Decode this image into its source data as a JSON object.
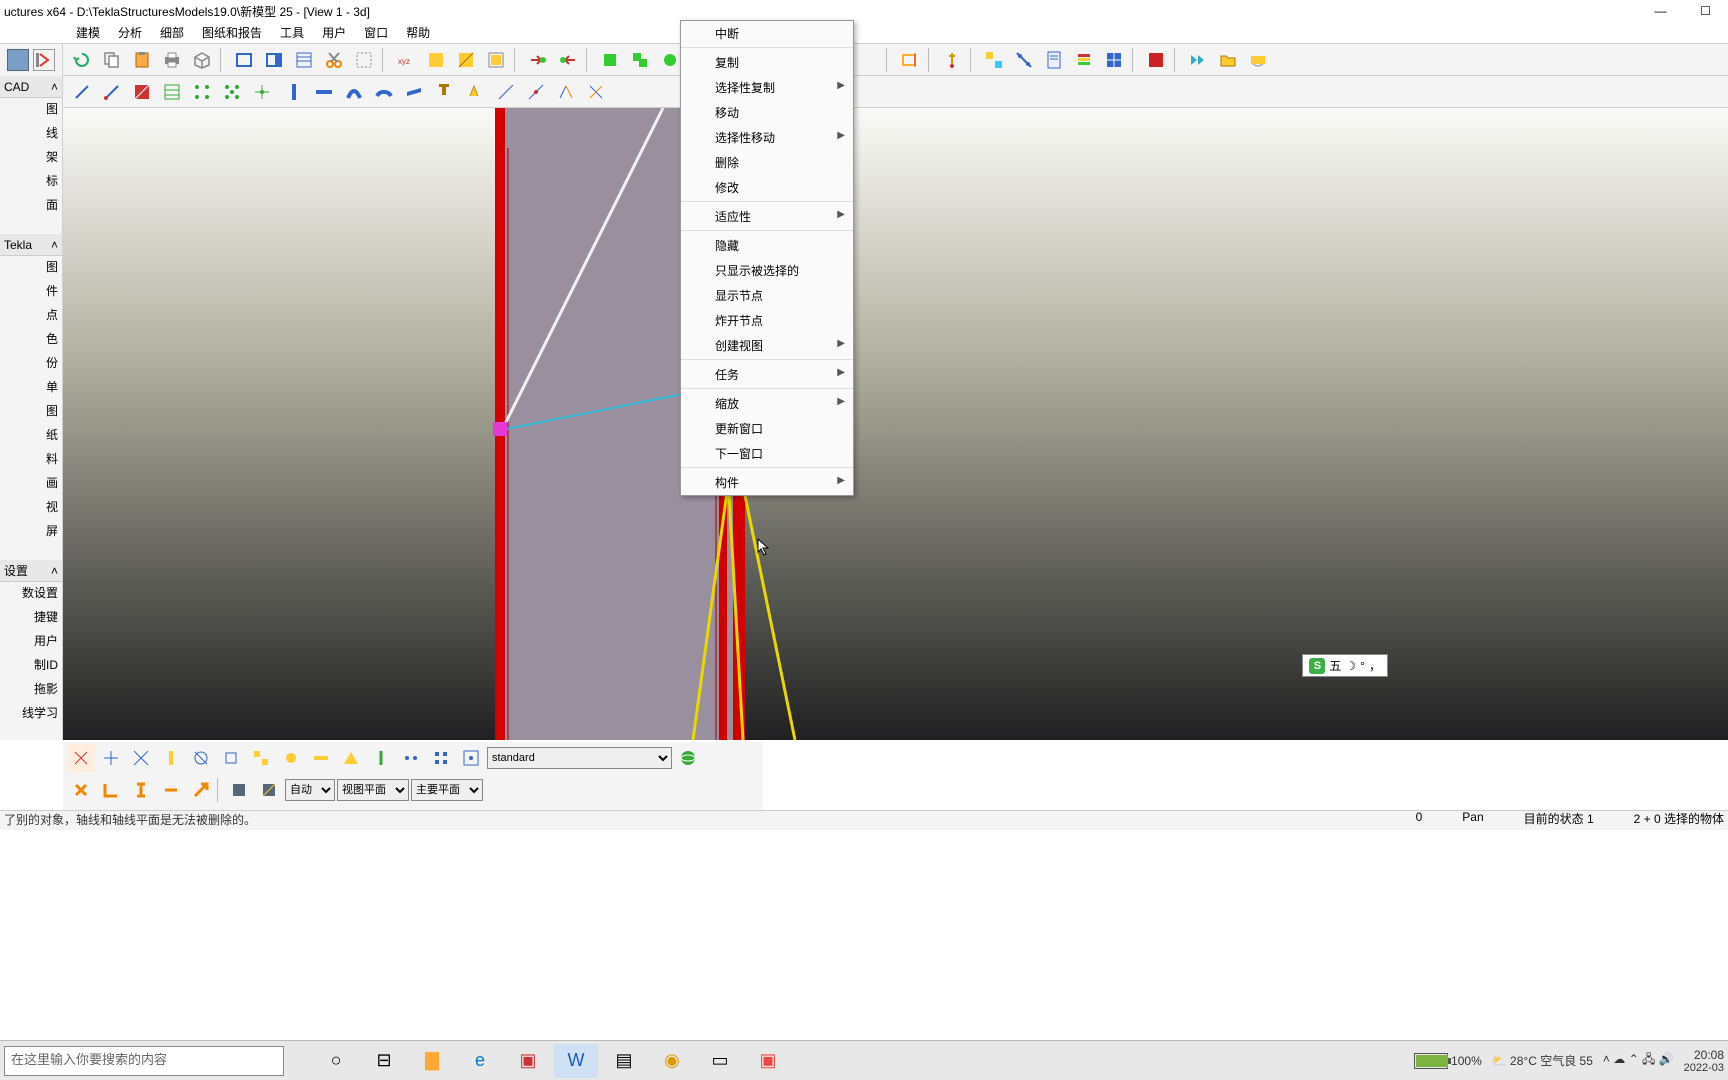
{
  "title": "uctures x64 - D:\\TeklaStructuresModels19.0\\新模型 25 - [View 1 - 3d]",
  "menu": [
    "建模",
    "分析",
    "细部",
    "图纸和报告",
    "工具",
    "用户",
    "窗口",
    "帮助"
  ],
  "side": {
    "hdr1": "CAD",
    "items1": [
      "图",
      "线",
      "架",
      "标",
      "面"
    ],
    "hdr2": "Tekla",
    "items2": [
      "图",
      "件",
      "点",
      "色",
      "份",
      "单",
      "图",
      "纸",
      "料",
      "画",
      "视",
      "屏"
    ],
    "hdr3": "设置",
    "items3": [
      "数设置",
      "捷键",
      "用户",
      "制ID",
      "拖影",
      "线学习"
    ]
  },
  "ctx": [
    {
      "l": "中断",
      "a": false,
      "s": true
    },
    {
      "l": "复制",
      "a": false
    },
    {
      "l": "选择性复制",
      "a": true
    },
    {
      "l": "移动",
      "a": false
    },
    {
      "l": "选择性移动",
      "a": true
    },
    {
      "l": "删除",
      "a": false
    },
    {
      "l": "修改",
      "a": false,
      "s": true
    },
    {
      "l": "适应性",
      "a": true,
      "s": true
    },
    {
      "l": "隐藏",
      "a": false
    },
    {
      "l": "只显示被选择的",
      "a": false
    },
    {
      "l": "显示节点",
      "a": false
    },
    {
      "l": "炸开节点",
      "a": false
    },
    {
      "l": "创建视图",
      "a": true,
      "s": true
    },
    {
      "l": "任务",
      "a": true,
      "s": true
    },
    {
      "l": "缩放",
      "a": true
    },
    {
      "l": "更新窗口",
      "a": false
    },
    {
      "l": "下一窗口",
      "a": false,
      "s": true
    },
    {
      "l": "构件",
      "a": true
    }
  ],
  "bottom": {
    "sel1": "standard",
    "sel2": "自动",
    "sel3": "视图平面",
    "sel4": "主要平面"
  },
  "status": {
    "msg": "了别的对象，轴线和轴线平面是无法被删除的。",
    "num": "0",
    "mode": "Pan",
    "state": "目前的状态 1",
    "sel": "2 + 0 选择的物体"
  },
  "taskbar": {
    "search": "在这里输入你要搜索的内容",
    "weather": "28°C 空气良 55",
    "time": "20:08",
    "date": "2022-03",
    "battery": "100%"
  },
  "ime": "五"
}
